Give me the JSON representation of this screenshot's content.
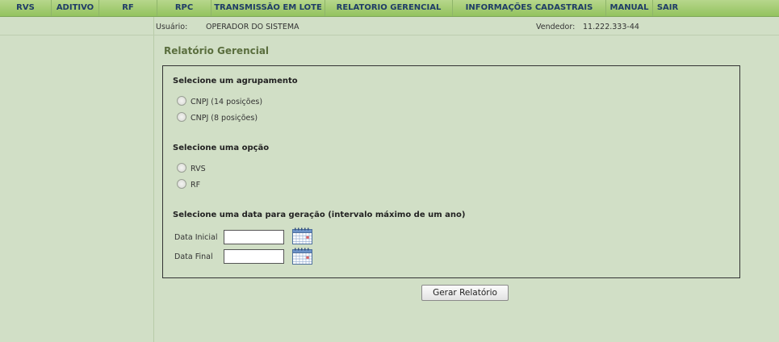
{
  "menu": {
    "items": [
      {
        "label": "RVS"
      },
      {
        "label": "ADITIVO"
      },
      {
        "label": "RF"
      },
      {
        "label": "RPC"
      },
      {
        "label": "TRANSMISSÃO EM LOTE"
      },
      {
        "label": "RELATORIO GERENCIAL"
      },
      {
        "label": "INFORMAÇÕES CADASTRAIS"
      },
      {
        "label": "MANUAL"
      },
      {
        "label": "SAIR"
      }
    ]
  },
  "header": {
    "usuario_label": "Usuário:",
    "usuario_value": "OPERADOR DO SISTEMA",
    "vendedor_label": "Vendedor:",
    "vendedor_value": "11.222.333-44"
  },
  "page": {
    "title": "Relatório Gerencial"
  },
  "form": {
    "agrupamento": {
      "title": "Selecione um agrupamento",
      "options": [
        {
          "label": "CNPJ (14 posições)",
          "checked": false
        },
        {
          "label": "CNPJ (8 posições)",
          "checked": false
        }
      ]
    },
    "opcao": {
      "title": "Selecione uma opção",
      "options": [
        {
          "label": "RVS",
          "checked": false
        },
        {
          "label": "RF",
          "checked": false
        }
      ]
    },
    "data": {
      "title": "Selecione uma data para geração (intervalo máximo de um ano)",
      "inicial_label": "Data Inicial",
      "inicial_value": "",
      "final_label": "Data Final",
      "final_value": ""
    },
    "submit_label": "Gerar Relatório"
  },
  "icons": {
    "calendar": "calendar-icon"
  },
  "colors": {
    "background": "#d1dfc6",
    "menubar": "#a6cd76",
    "menu_text": "#1f3c67",
    "title": "#5a6e3e"
  }
}
